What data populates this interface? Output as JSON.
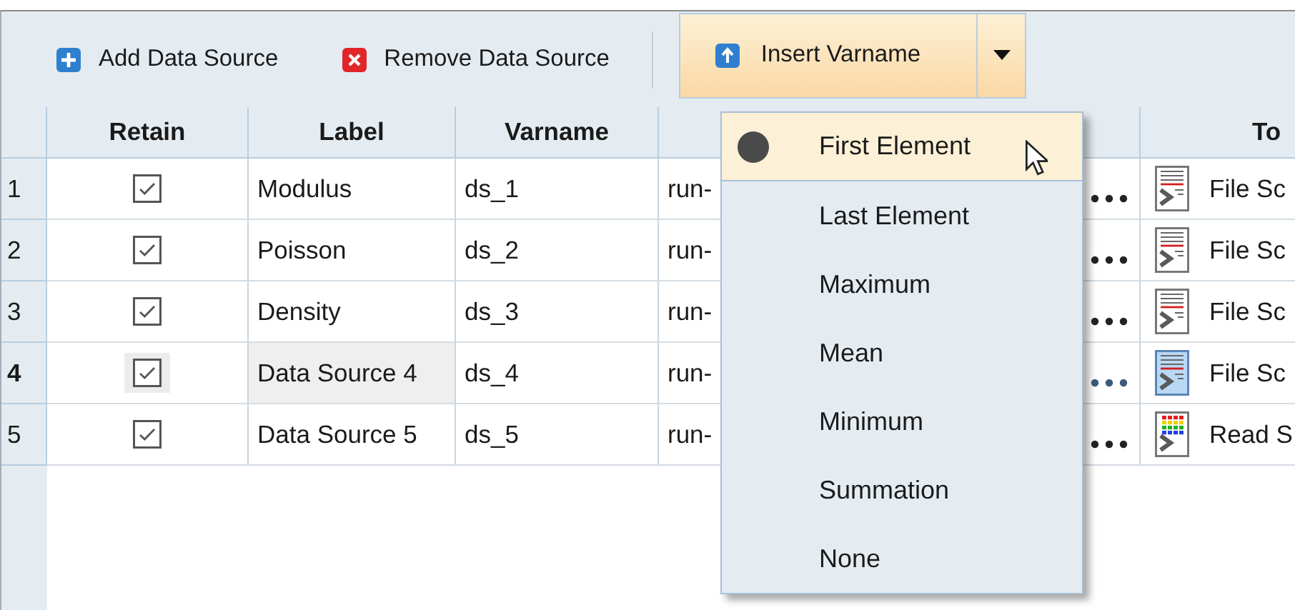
{
  "toolbar": {
    "buttons": [
      {
        "kind": "add",
        "label": "Add Data Source"
      },
      {
        "kind": "remove",
        "label": "Remove Data Source"
      }
    ],
    "split_button": {
      "kind": "insert",
      "label": "Insert Varname"
    }
  },
  "table": {
    "columns": {
      "retain": "Retain",
      "label": "Label",
      "varname": "Varname",
      "column_5": "To"
    },
    "rows": [
      {
        "number": "1",
        "retain": true,
        "label": "Modulus",
        "varname": "ds_1",
        "column_4": "run-",
        "selected": false,
        "tool": {
          "kind": "file",
          "text": "File Sc"
        }
      },
      {
        "number": "2",
        "retain": true,
        "label": "Poisson",
        "varname": "ds_2",
        "column_4": "run-",
        "selected": false,
        "tool": {
          "kind": "file",
          "text": "File Sc"
        }
      },
      {
        "number": "3",
        "retain": true,
        "label": "Density",
        "varname": "ds_3",
        "column_4": "run-",
        "selected": false,
        "tool": {
          "kind": "file",
          "text": "File Sc"
        }
      },
      {
        "number": "4",
        "retain": true,
        "label": "Data Source 4",
        "varname": "ds_4",
        "column_4": "run-",
        "selected": true,
        "tool": {
          "kind": "file",
          "text": "File Sc"
        }
      },
      {
        "number": "5",
        "retain": true,
        "label": "Data Source 5",
        "varname": "ds_5",
        "column_4": "run-",
        "selected": false,
        "tool": {
          "kind": "grid",
          "text": "Read S"
        }
      }
    ]
  },
  "dropdown_menu": {
    "items": [
      {
        "label": "First Element",
        "selected": true
      },
      {
        "label": "Last Element",
        "selected": false
      },
      {
        "label": "Maximum",
        "selected": false
      },
      {
        "label": "Mean",
        "selected": false
      },
      {
        "label": "Minimum",
        "selected": false
      },
      {
        "label": "Summation",
        "selected": false
      },
      {
        "label": "None",
        "selected": false
      }
    ]
  }
}
